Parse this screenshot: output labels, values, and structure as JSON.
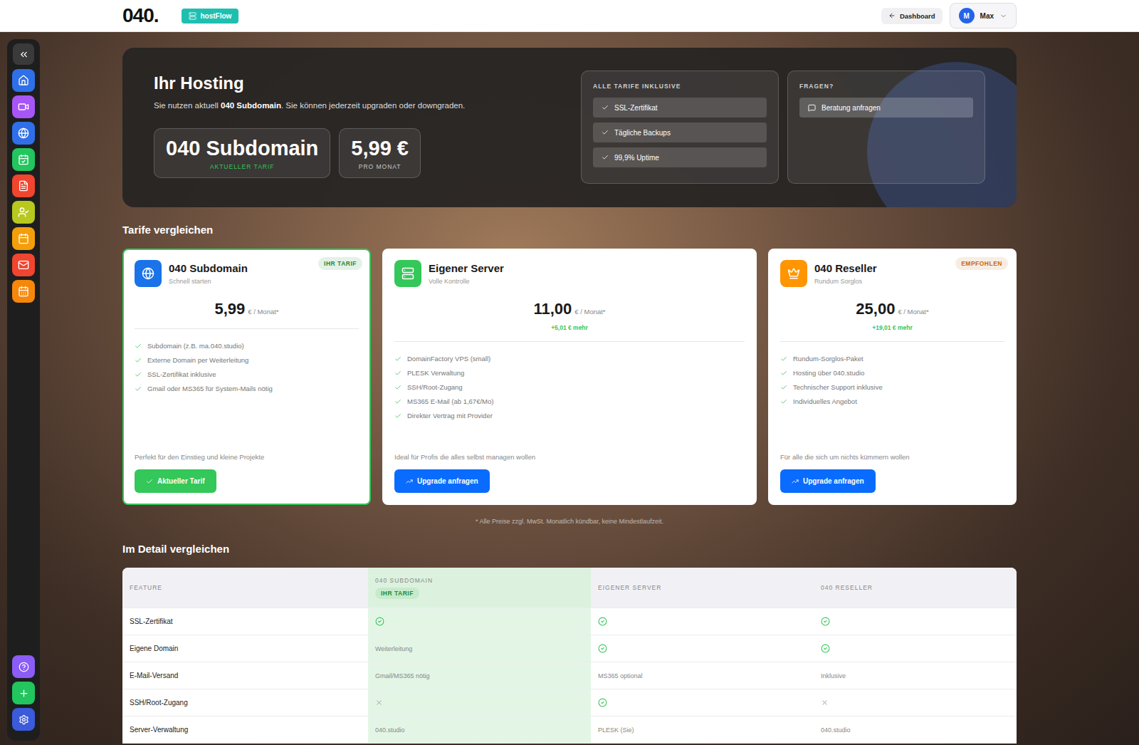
{
  "topbar": {
    "logo": "040.",
    "app": "hostFlow",
    "back_button": "Dashboard",
    "user": {
      "initial": "M",
      "name": "Max"
    }
  },
  "sidebar": {
    "items": [
      {
        "color": "#2f6fe8"
      },
      {
        "color": "#a855f7"
      },
      {
        "color": "#2f6fe8"
      },
      {
        "color": "#22c55e"
      },
      {
        "color": "#f0452f"
      },
      {
        "color": "#b8c81e"
      },
      {
        "color": "#f59e0b"
      },
      {
        "color": "#f0452f"
      },
      {
        "color": "#f5870b"
      }
    ],
    "bottom_items": [
      {
        "color": "#8b5cf6"
      },
      {
        "color": "#22c55e"
      },
      {
        "color": "#3b5bdb"
      }
    ]
  },
  "hero": {
    "title": "Ihr Hosting",
    "subtitle": {
      "before": "Sie nutzen aktuell ",
      "plan": "040 Subdomain",
      "after": ". Sie können jederzeit upgraden oder downgraden."
    },
    "current": {
      "value": "040 Subdomain",
      "label": "AKTUELLER TARIF"
    },
    "price": {
      "value": "5,99 €",
      "label": "PRO MONAT"
    },
    "included": {
      "title": "ALLE TARIFE INKLUSIVE",
      "items": [
        "SSL-Zertifikat",
        "Tägliche Backups",
        "99,9% Uptime"
      ]
    },
    "questions": {
      "title": "FRAGEN?",
      "button": "Beratung anfragen"
    }
  },
  "plans_title": "Tarife vergleichen",
  "plans": [
    {
      "name": "040 Subdomain",
      "tagline": "Schnell starten",
      "color": "#1a73e8",
      "price": "5,99",
      "unit": "€ / Monat*",
      "diff": "",
      "badge": "IHR TARIF",
      "badge_color": "#1f8a3a",
      "selected": true,
      "features": [
        "Subdomain (z.B. ma.040.studio)",
        "Externe Domain per Weiterleitung",
        "SSL-Zertifikat inklusive",
        "Gmail oder MS365 für System-Mails nötig"
      ],
      "note": "Perfekt für den Einstieg und kleine Projekte",
      "button": {
        "label": "Aktueller Tarif",
        "kind": "current"
      }
    },
    {
      "name": "Eigener Server",
      "tagline": "Volle Kontrolle",
      "color": "#34c759",
      "price": "11,00",
      "unit": "€ / Monat*",
      "diff": "+5,01 € mehr",
      "badge": "",
      "badge_color": "#888888",
      "selected": false,
      "features": [
        "DomainFactory VPS (small)",
        "PLESK Verwaltung",
        "SSH/Root-Zugang",
        "MS365 E-Mail (ab 1,67€/Mo)",
        "Direkter Vertrag mit Provider"
      ],
      "note": "Ideal für Profis die alles selbst managen wollen",
      "button": {
        "label": "Upgrade anfragen",
        "kind": "upgrade"
      }
    },
    {
      "name": "040 Reseller",
      "tagline": "Rundum Sorglos",
      "color": "#ff9500",
      "price": "25,00",
      "unit": "€ / Monat*",
      "diff": "+19,01 € mehr",
      "badge": "EMPFOHLEN",
      "badge_color": "#c46a12",
      "selected": false,
      "features": [
        "Rundum-Sorglos-Paket",
        "Hosting über 040.studio",
        "Technischer Support inklusive",
        "Individuelles Angebot"
      ],
      "note": "Für alle die sich um nichts kümmern wollen",
      "button": {
        "label": "Upgrade anfragen",
        "kind": "upgrade"
      }
    }
  ],
  "footnote": "* Alle Preise zzgl. MwSt. Monatlich kündbar, keine Mindestlaufzeit.",
  "table": {
    "title": "Im Detail vergleichen",
    "columns": [
      {
        "label": "FEATURE",
        "badge": "",
        "selected": false
      },
      {
        "label": "040 SUBDOMAIN",
        "badge": "IHR TARIF",
        "selected": true
      },
      {
        "label": "EIGENER SERVER",
        "badge": "",
        "selected": false
      },
      {
        "label": "040 RESELLER",
        "badge": "",
        "selected": false
      }
    ],
    "rows": [
      {
        "feature": "SSL-Zertifikat",
        "cells": [
          {
            "kind": "check",
            "text": ""
          },
          {
            "kind": "check",
            "text": ""
          },
          {
            "kind": "check",
            "text": ""
          }
        ]
      },
      {
        "feature": "Eigene Domain",
        "cells": [
          {
            "kind": "text",
            "text": "Weiterleitung"
          },
          {
            "kind": "check",
            "text": ""
          },
          {
            "kind": "check",
            "text": ""
          }
        ]
      },
      {
        "feature": "E-Mail-Versand",
        "cells": [
          {
            "kind": "text",
            "text": "Gmail/MS365 nötig"
          },
          {
            "kind": "text",
            "text": "MS365 optional"
          },
          {
            "kind": "text",
            "text": "Inklusive"
          }
        ]
      },
      {
        "feature": "SSH/Root-Zugang",
        "cells": [
          {
            "kind": "cross",
            "text": ""
          },
          {
            "kind": "check",
            "text": ""
          },
          {
            "kind": "cross",
            "text": ""
          }
        ]
      },
      {
        "feature": "Server-Verwaltung",
        "cells": [
          {
            "kind": "text",
            "text": "040.studio"
          },
          {
            "kind": "text",
            "text": "PLESK (Sie)"
          },
          {
            "kind": "text",
            "text": "040.studio"
          }
        ]
      }
    ]
  }
}
